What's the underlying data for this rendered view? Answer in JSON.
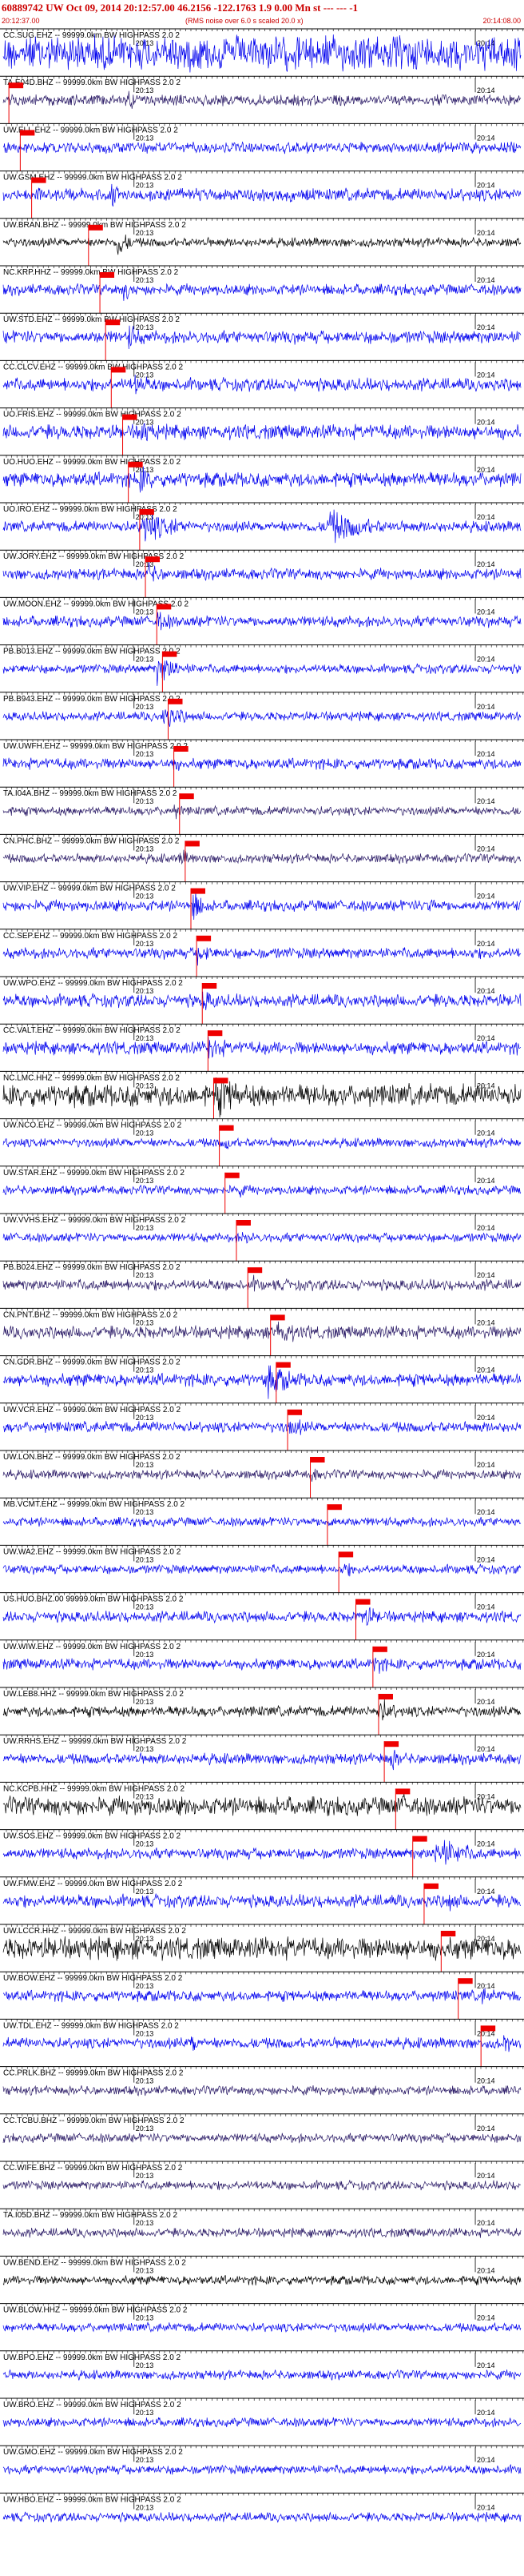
{
  "header": {
    "title": "60889742 UW Oct 09, 2014 20:12:57.00   46.2156 -122.1763   1.9 0.00 Mn st --- --- -1",
    "start_time": "20:12:37.00",
    "note": "(RMS noise over 6.0 s scaled 20.0 x)",
    "end_time": "20:14:08.00"
  },
  "tick_labels": {
    "minute_a": "20:13",
    "minute_b": "20:14"
  },
  "chart_data": {
    "type": "line",
    "x_range_seconds": [
      0,
      91
    ],
    "x_ticks": [
      "20:13",
      "20:14"
    ],
    "colors": {
      "blue": "#0000ee",
      "navy": "#2a1a66",
      "black": "#000000",
      "pick": "#ee0000"
    },
    "traces": [
      {
        "label": "CC.SUG.EHZ -- 99999.0km BW  HIGHPASS  2.0  2",
        "color": "blue",
        "amp": 0.95,
        "events": []
      },
      {
        "label": "TA.E04D.BHZ -- 99999.0km BW  HIGHPASS  2.0  2",
        "color": "navy",
        "amp": 0.3,
        "events": [
          [
            22,
            6,
            0.5
          ]
        ]
      },
      {
        "label": "UW.ELL.EHZ -- 99999.0km BW  HIGHPASS  2.0  2",
        "color": "blue",
        "amp": 0.3,
        "events": [
          [
            18,
            4,
            0.5
          ]
        ]
      },
      {
        "label": "UW.GSM.EHZ -- 99999.0km BW  HIGHPASS  2.0  2",
        "color": "blue",
        "amp": 0.35,
        "events": [
          [
            19,
            5,
            0.6
          ]
        ]
      },
      {
        "label": "UW.BRAN.BHZ -- 99999.0km BW  HIGHPASS  2.0  2",
        "color": "black",
        "amp": 0.25,
        "events": [
          [
            20,
            4,
            1.0
          ]
        ]
      },
      {
        "label": "NC.KRP.HHZ -- 99999.0km BW  HIGHPASS  2.0  2",
        "color": "blue",
        "amp": 0.3,
        "events": [
          [
            21,
            5,
            0.6
          ]
        ]
      },
      {
        "label": "UW.STD.EHZ -- 99999.0km BW  HIGHPASS  2.0  2",
        "color": "blue",
        "amp": 0.35,
        "events": [
          [
            22,
            6,
            0.7
          ]
        ]
      },
      {
        "label": "CC.CLCV.EHZ -- 99999.0km BW  HIGHPASS  2.0  2",
        "color": "blue",
        "amp": 0.35,
        "events": [
          [
            23,
            6,
            0.7
          ]
        ]
      },
      {
        "label": "UO.FRIS.EHZ -- 99999.0km BW  HIGHPASS  2.0  2",
        "color": "blue",
        "amp": 0.4,
        "events": [
          [
            24,
            6,
            0.8
          ]
        ]
      },
      {
        "label": "UO.HUO.EHZ -- 99999.0km BW  HIGHPASS  2.0  2",
        "color": "blue",
        "amp": 0.4,
        "events": [
          [
            24,
            6,
            0.8
          ]
        ]
      },
      {
        "label": "UO.IRO.EHZ -- 99999.0km BW  HIGHPASS  2.0  2",
        "color": "blue",
        "amp": 0.3,
        "events": [
          [
            24,
            14,
            1.0
          ],
          [
            57,
            16,
            1.0
          ]
        ]
      },
      {
        "label": "UW.JORY.EHZ -- 99999.0km BW  HIGHPASS  2.0  2",
        "color": "blue",
        "amp": 0.3,
        "events": [
          [
            25,
            8,
            0.6
          ]
        ]
      },
      {
        "label": "UW.MOON.EHZ -- 99999.0km BW  HIGHPASS  2.0  2",
        "color": "blue",
        "amp": 0.3,
        "events": [
          [
            27,
            7,
            0.6
          ]
        ]
      },
      {
        "label": "PB.B013.EHZ -- 99999.0km BW  HIGHPASS  2.0  2",
        "color": "blue",
        "amp": 0.25,
        "events": [
          [
            27,
            9,
            0.9
          ]
        ]
      },
      {
        "label": "PB.B943.EHZ -- 99999.0km BW  HIGHPASS  2.0  2",
        "color": "blue",
        "amp": 0.25,
        "events": [
          [
            28,
            8,
            0.8
          ]
        ]
      },
      {
        "label": "UW.UWFH.EHZ -- 99999.0km BW  HIGHPASS  2.0  2",
        "color": "blue",
        "amp": 0.3,
        "events": [
          [
            29,
            6,
            0.5
          ]
        ]
      },
      {
        "label": "TA.I04A.BHZ -- 99999.0km BW  HIGHPASS  2.0  2",
        "color": "navy",
        "amp": 0.25,
        "events": [
          [
            30,
            6,
            0.4
          ]
        ]
      },
      {
        "label": "CN.PHC.BHZ -- 99999.0km BW  HIGHPASS  2.0  2",
        "color": "navy",
        "amp": 0.25,
        "events": [
          [
            31,
            6,
            0.5
          ]
        ]
      },
      {
        "label": "UW.VIP.EHZ -- 99999.0km BW  HIGHPASS  2.0  2",
        "color": "blue",
        "amp": 0.3,
        "events": [
          [
            33,
            5,
            1.0
          ],
          [
            75,
            2,
            0.9
          ]
        ]
      },
      {
        "label": "CC.SEP.EHZ -- 99999.0km BW  HIGHPASS  2.0  2",
        "color": "blue",
        "amp": 0.3,
        "events": [
          [
            34,
            8,
            0.6
          ]
        ]
      },
      {
        "label": "UW.WPO.EHZ -- 99999.0km BW  HIGHPASS  2.0  2",
        "color": "blue",
        "amp": 0.35,
        "events": [
          [
            35,
            7,
            0.6
          ]
        ]
      },
      {
        "label": "CC.VALT.EHZ -- 99999.0km BW  HIGHPASS  2.0  2",
        "color": "blue",
        "amp": 0.35,
        "events": [
          [
            36,
            7,
            0.8
          ]
        ]
      },
      {
        "label": "NC.LMC.HHZ -- 99999.0km BW  HIGHPASS  2.0  2",
        "color": "black",
        "amp": 0.6,
        "events": [
          [
            37,
            20,
            1.0
          ]
        ]
      },
      {
        "label": "UW.NCO.EHZ -- 99999.0km BW  HIGHPASS  2.0  2",
        "color": "blue",
        "amp": 0.25,
        "events": [
          [
            39,
            6,
            0.4
          ]
        ]
      },
      {
        "label": "UW.STAR.EHZ -- 99999.0km BW  HIGHPASS  2.0  2",
        "color": "blue",
        "amp": 0.25,
        "events": [
          [
            41,
            6,
            0.4
          ]
        ]
      },
      {
        "label": "UW.VVHS.EHZ -- 99999.0km BW  HIGHPASS  2.0  2",
        "color": "blue",
        "amp": 0.25,
        "events": [
          [
            42,
            6,
            0.4
          ]
        ]
      },
      {
        "label": "PB.B024.EHZ -- 99999.0km BW  HIGHPASS  2.0  2",
        "color": "navy",
        "amp": 0.3,
        "events": [
          [
            44,
            6,
            0.4
          ]
        ]
      },
      {
        "label": "CN.PNT.BHZ -- 99999.0km BW  HIGHPASS  2.0  2",
        "color": "navy",
        "amp": 0.35,
        "events": [
          [
            48,
            8,
            0.8
          ]
        ]
      },
      {
        "label": "CN.GDR.BHZ -- 99999.0km BW  HIGHPASS  2.0  2",
        "color": "blue",
        "amp": 0.35,
        "events": [
          [
            46,
            12,
            0.9
          ]
        ]
      },
      {
        "label": "UW.VCR.EHZ -- 99999.0km BW  HIGHPASS  2.0  2",
        "color": "blue",
        "amp": 0.3,
        "events": [
          [
            50,
            8,
            0.6
          ]
        ]
      },
      {
        "label": "UW.LON.BHZ -- 99999.0km BW  HIGHPASS  2.0  2",
        "color": "navy",
        "amp": 0.25,
        "events": [
          [
            54,
            6,
            0.4
          ]
        ]
      },
      {
        "label": "MB.VCMT.EHZ -- 99999.0km BW  HIGHPASS  2.0  2",
        "color": "blue",
        "amp": 0.25,
        "events": [
          [
            57,
            6,
            0.4
          ]
        ]
      },
      {
        "label": "UW.WA2.EHZ -- 99999.0km BW  HIGHPASS  2.0  2",
        "color": "blue",
        "amp": 0.25,
        "events": [
          [
            60,
            6,
            0.4
          ]
        ]
      },
      {
        "label": "US.HUO.BHZ.00 99999.0km BW  HIGHPASS  2.0  2",
        "color": "blue",
        "amp": 0.3,
        "events": [
          [
            63,
            7,
            0.7
          ]
        ]
      },
      {
        "label": "UW.WIW.EHZ -- 99999.0km BW  HIGHPASS  2.0  2",
        "color": "blue",
        "amp": 0.3,
        "events": [
          [
            65,
            6,
            0.6
          ]
        ]
      },
      {
        "label": "UW.LEB8.HHZ -- 99999.0km BW  HIGHPASS  2.0  2",
        "color": "black",
        "amp": 0.3,
        "events": [
          [
            66,
            6,
            0.8
          ]
        ]
      },
      {
        "label": "UW.RRHS.EHZ -- 99999.0km BW  HIGHPASS  2.0  2",
        "color": "blue",
        "amp": 0.3,
        "events": [
          [
            68,
            6,
            0.6
          ]
        ]
      },
      {
        "label": "NC.KCPB.HHZ -- 99999.0km BW  HIGHPASS  2.0  2",
        "color": "black",
        "amp": 0.5,
        "events": [
          [
            70,
            10,
            0.6
          ]
        ]
      },
      {
        "label": "UW.SOS.EHZ -- 99999.0km BW  HIGHPASS  2.0  2",
        "color": "blue",
        "amp": 0.3,
        "events": [
          [
            76,
            12,
            1.0
          ]
        ]
      },
      {
        "label": "UW.FMW.EHZ -- 99999.0km BW  HIGHPASS  2.0  2",
        "color": "blue",
        "amp": 0.35,
        "events": [
          [
            78,
            6,
            0.6
          ]
        ]
      },
      {
        "label": "UW.LCCR.HHZ -- 99999.0km BW  HIGHPASS  2.0  2",
        "color": "black",
        "amp": 0.6,
        "events": [
          [
            82,
            6,
            0.4
          ]
        ]
      },
      {
        "label": "UW.BOW.EHZ -- 99999.0km BW  HIGHPASS  2.0  2",
        "color": "blue",
        "amp": 0.3,
        "events": [
          [
            84,
            6,
            0.5
          ]
        ]
      },
      {
        "label": "UW.TDL.EHZ -- 99999.0km BW  HIGHPASS  2.0  2",
        "color": "blue",
        "amp": 0.3,
        "events": [
          [
            33,
            3,
            0.8
          ],
          [
            88,
            4,
            0.6
          ]
        ]
      },
      {
        "label": "CC.PRLK.BHZ -- 99999.0km BW  HIGHPASS  2.0  2",
        "color": "navy",
        "amp": 0.25,
        "events": []
      },
      {
        "label": "CC.TCBU.BHZ -- 99999.0km BW  HIGHPASS  2.0  2",
        "color": "navy",
        "amp": 0.25,
        "events": []
      },
      {
        "label": "CC.WIFE.BHZ -- 99999.0km BW  HIGHPASS  2.0  2",
        "color": "navy",
        "amp": 0.25,
        "events": []
      },
      {
        "label": "TA.I05D.BHZ -- 99999.0km BW  HIGHPASS  2.0  2",
        "color": "navy",
        "amp": 0.25,
        "events": []
      },
      {
        "label": "UW.BEND.EHZ -- 99999.0km BW  HIGHPASS  2.0  2",
        "color": "black",
        "amp": 0.25,
        "events": []
      },
      {
        "label": "UW.BLOW.HHZ -- 99999.0km BW  HIGHPASS  2.0  2",
        "color": "blue",
        "amp": 0.25,
        "events": []
      },
      {
        "label": "UW.BPO.EHZ -- 99999.0km BW  HIGHPASS  2.0  2",
        "color": "blue",
        "amp": 0.25,
        "events": []
      },
      {
        "label": "UW.BRO.EHZ -- 99999.0km BW  HIGHPASS  2.0  2",
        "color": "blue",
        "amp": 0.25,
        "events": []
      },
      {
        "label": "UW.GMO.EHZ -- 99999.0km BW  HIGHPASS  2.0  2",
        "color": "blue",
        "amp": 0.25,
        "events": []
      },
      {
        "label": "UW.HBO.EHZ -- 99999.0km BW  HIGHPASS  2.0  2",
        "color": "blue",
        "amp": 0.25,
        "events": []
      }
    ],
    "pick_times_seconds": [
      null,
      1,
      3,
      5,
      15,
      17,
      18,
      19,
      21,
      22,
      24,
      25,
      27,
      28,
      29,
      30,
      31,
      32,
      33,
      34,
      35,
      36,
      37,
      38,
      39,
      41,
      43,
      47,
      48,
      50,
      54,
      57,
      59,
      62,
      65,
      66,
      67,
      69,
      72,
      74,
      77,
      80,
      84,
      null,
      null,
      null,
      null,
      null,
      null,
      null,
      null,
      null,
      null
    ]
  }
}
